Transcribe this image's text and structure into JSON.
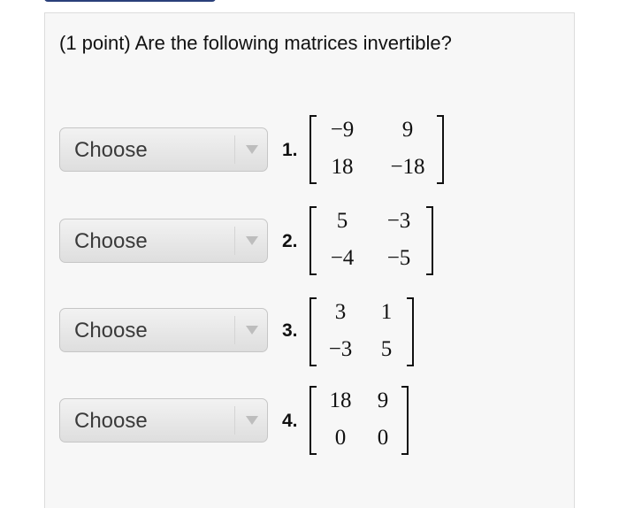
{
  "question": "(1 point) Are the following matrices invertible?",
  "items": [
    {
      "select": "Choose",
      "number": "1.",
      "matrix": [
        [
          "−9",
          "9"
        ],
        [
          "18",
          "−18"
        ]
      ]
    },
    {
      "select": "Choose",
      "number": "2.",
      "matrix": [
        [
          "5",
          "−3"
        ],
        [
          "−4",
          "−5"
        ]
      ]
    },
    {
      "select": "Choose",
      "number": "3.",
      "matrix": [
        [
          "3",
          "1"
        ],
        [
          "−3",
          "5"
        ]
      ]
    },
    {
      "select": "Choose",
      "number": "4.",
      "matrix": [
        [
          "18",
          "9"
        ],
        [
          "0",
          "0"
        ]
      ]
    }
  ],
  "icons": {
    "dropdown": "chevron-down-icon"
  },
  "colors": {
    "panel_bg": "#f7f7f7",
    "header_tab": "#2a3f7a"
  }
}
